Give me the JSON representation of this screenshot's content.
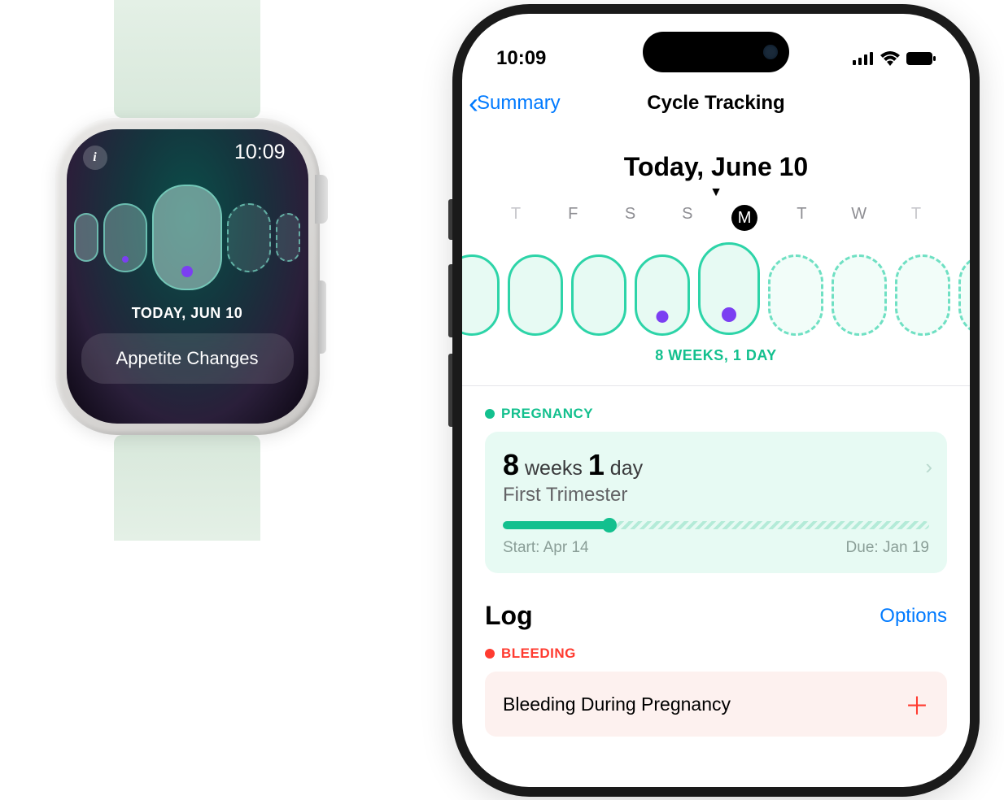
{
  "watch": {
    "time": "10:09",
    "date_label": "TODAY, JUN 10",
    "symptom": "Appetite Changes"
  },
  "phone": {
    "statusbar": {
      "time": "10:09"
    },
    "nav": {
      "back": "Summary",
      "title": "Cycle Tracking"
    },
    "date_heading": "Today, June 10",
    "week_days": [
      "T",
      "F",
      "S",
      "S",
      "M",
      "T",
      "W",
      "T"
    ],
    "gestation_text": "8 WEEKS, 1 DAY",
    "pregnancy": {
      "section": "PREGNANCY",
      "weeks_num": "8",
      "weeks_word": "weeks",
      "days_num": "1",
      "days_word": "day",
      "trimester": "First Trimester",
      "start_label": "Start: Apr 14",
      "due_label": "Due: Jan 19"
    },
    "log": {
      "title": "Log",
      "options": "Options",
      "bleeding_section": "BLEEDING",
      "item": "Bleeding During Pregnancy"
    }
  }
}
